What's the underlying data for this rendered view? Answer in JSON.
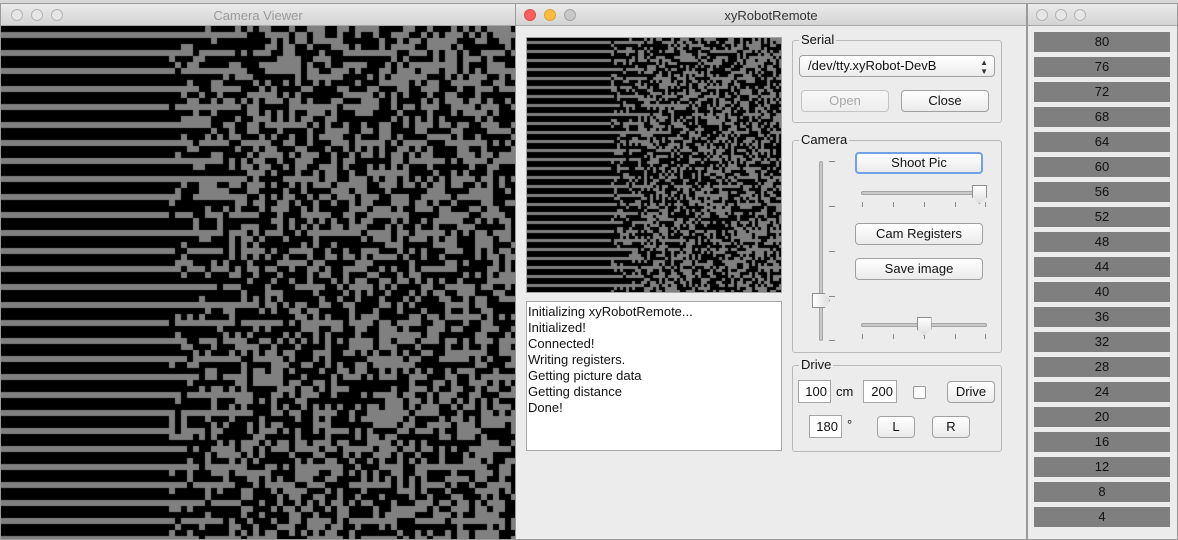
{
  "windows": {
    "camera_viewer": {
      "title": "Camera Viewer"
    },
    "remote": {
      "title": "xyRobotRemote"
    },
    "scale": {
      "title": ""
    }
  },
  "serial": {
    "group_title": "Serial",
    "port_selected": "/dev/tty.xyRobot-DevB",
    "open_label": "Open",
    "close_label": "Close"
  },
  "camera": {
    "group_title": "Camera",
    "shoot_label": "Shoot Pic",
    "registers_label": "Cam Registers",
    "save_label": "Save image",
    "slider_top_value": 1.0,
    "slider_bottom_value": 0.5,
    "vertical_slider_value": 0.2
  },
  "drive": {
    "group_title": "Drive",
    "distance_value": "100",
    "distance_unit": "cm",
    "speed_value": "200",
    "drive_label": "Drive",
    "angle_value": "180",
    "angle_unit": "°",
    "left_label": "L",
    "right_label": "R"
  },
  "log": {
    "lines": [
      "Initializing xyRobotRemote...",
      "Initialized!",
      "Connected!",
      "Writing registers.",
      "Getting picture data",
      "Getting distance",
      "Done!"
    ]
  },
  "scale": {
    "values": [
      "80",
      "76",
      "72",
      "68",
      "64",
      "60",
      "56",
      "52",
      "48",
      "44",
      "40",
      "36",
      "32",
      "28",
      "24",
      "20",
      "16",
      "12",
      "8",
      "4"
    ]
  },
  "colors": {
    "pixel_on": "#808080",
    "pixel_off": "#000000",
    "scale_row": "#7f7f7f"
  }
}
